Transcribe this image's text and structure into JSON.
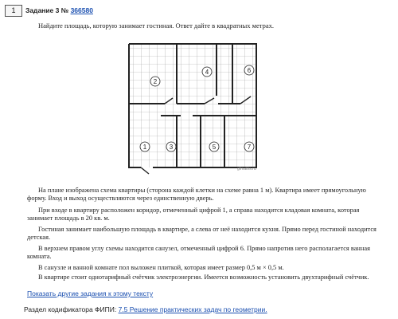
{
  "task": {
    "number": "1",
    "title_prefix": "Задание 3 №",
    "id_link": "366580",
    "question": "Найдите площадь, которую занимает гостиная. Ответ дайте в квадратных метрах."
  },
  "plan": {
    "room_labels": [
      "1",
      "2",
      "3",
      "4",
      "5",
      "6",
      "7"
    ],
    "credit": "gfmaths.ru"
  },
  "paragraphs": [
    "На плане изображена схема квартиры (сторона каждой клетки на схеме равна 1 м). Квартира имеет прямоугольную форму. Вход и выход осуществляются через единственную дверь.",
    "При входе в квартиру расположен коридор, отмеченный цифрой 1, а справа находится кладовая комната, которая занимает площадь в 20 кв. м.",
    "Гостиная занимает наибольшую площадь в квартире, а слева от неё находится кухня. Прямо перед гостиной находится детская.",
    "В верхнем правом углу схемы находится санузел, отмеченный цифрой 6. Прямо напротив него располагается ванная комната.",
    "В санузле и ванной комнате пол выложен плиткой, которая имеет размер 0,5 м × 0,5 м.",
    "В квартире стоит однотарифный счётчик электроэнергии. Имеется возможность установить двухтарифный счётчик."
  ],
  "show_other_link": "Показать другие задания к этому тексту",
  "codifier": {
    "label": "Раздел кодификатора ФИПИ:",
    "link": "7.5 Решение практических задач по геометрии."
  }
}
